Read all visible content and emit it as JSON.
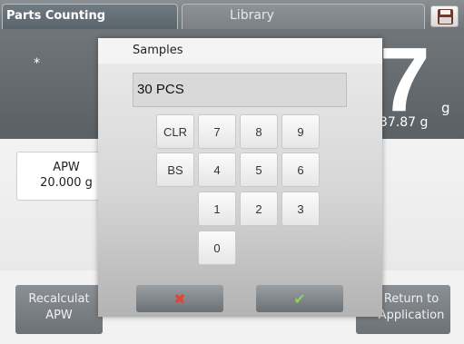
{
  "header": {
    "app_title": "Parts Counting",
    "library_tab": "Library",
    "save_icon": "floppy-disk-icon"
  },
  "display": {
    "stable_mark": "*",
    "main_value": "7",
    "unit": "g",
    "secondary_value": "37.87 g"
  },
  "apw": {
    "label": "APW",
    "value": "20.000 g"
  },
  "buttons": {
    "recalc_line1": "Recalculat",
    "recalc_line2": "APW",
    "return_line1": "Return to",
    "return_line2": "Application"
  },
  "dialog": {
    "title": "Samples",
    "entry_value": "30 PCS",
    "keys": {
      "clr": "CLR",
      "bs": "BS",
      "k7": "7",
      "k8": "8",
      "k9": "9",
      "k4": "4",
      "k5": "5",
      "k6": "6",
      "k1": "1",
      "k2": "2",
      "k3": "3",
      "k0": "0"
    },
    "cancel_icon": "x-icon",
    "ok_icon": "checkmark-icon"
  },
  "colors": {
    "cancel_accent": "#e0453a",
    "ok_accent": "#8bd35a",
    "dark_band": "#5b6064"
  }
}
